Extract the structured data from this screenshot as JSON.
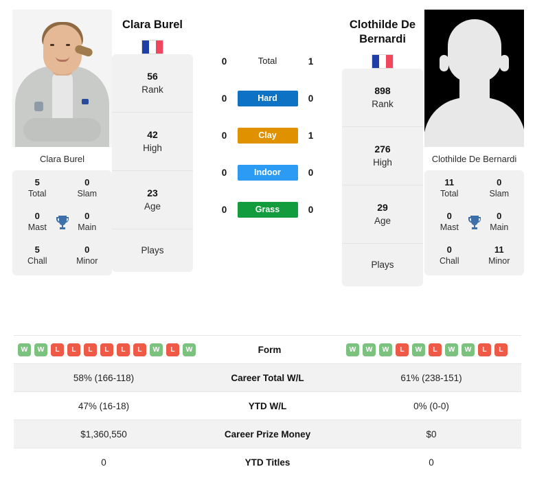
{
  "players": {
    "left": {
      "name": "Clara Burel",
      "photo_caption": "Clara Burel",
      "flag": "fr",
      "titles": {
        "total_value": "5",
        "total_label": "Total",
        "slam_value": "0",
        "slam_label": "Slam",
        "mast_value": "0",
        "mast_label": "Mast",
        "main_value": "0",
        "main_label": "Main",
        "chall_value": "5",
        "chall_label": "Chall",
        "minor_value": "0",
        "minor_label": "Minor"
      },
      "rank_value": "56",
      "rank_label": "Rank",
      "high_value": "42",
      "high_label": "High",
      "age_value": "23",
      "age_label": "Age",
      "plays_label": "Plays",
      "form": [
        "W",
        "W",
        "L",
        "L",
        "L",
        "L",
        "L",
        "L",
        "W",
        "L",
        "W"
      ],
      "career_total_wl": "58% (166-118)",
      "ytd_wl": "47% (16-18)",
      "career_prize_money": "$1,360,550",
      "ytd_titles": "0"
    },
    "right": {
      "name": "Clothilde De Bernardi",
      "photo_caption": "Clothilde De Bernardi",
      "flag": "fr",
      "titles": {
        "total_value": "11",
        "total_label": "Total",
        "slam_value": "0",
        "slam_label": "Slam",
        "mast_value": "0",
        "mast_label": "Mast",
        "main_value": "0",
        "main_label": "Main",
        "chall_value": "0",
        "chall_label": "Chall",
        "minor_value": "11",
        "minor_label": "Minor"
      },
      "rank_value": "898",
      "rank_label": "Rank",
      "high_value": "276",
      "high_label": "High",
      "age_value": "29",
      "age_label": "Age",
      "plays_label": "Plays",
      "form": [
        "W",
        "W",
        "W",
        "L",
        "W",
        "L",
        "W",
        "W",
        "L",
        "L"
      ],
      "career_total_wl": "61% (238-151)",
      "ytd_wl": "0% (0-0)",
      "career_prize_money": "$0",
      "ytd_titles": "0"
    }
  },
  "h2h": {
    "rows": [
      {
        "label": "Total",
        "left": "0",
        "right": "1",
        "color": null
      },
      {
        "label": "Hard",
        "left": "0",
        "right": "0",
        "color": "#0d72c4"
      },
      {
        "label": "Clay",
        "left": "0",
        "right": "1",
        "color": "#e09100"
      },
      {
        "label": "Indoor",
        "left": "0",
        "right": "0",
        "color": "#2b9bf4"
      },
      {
        "label": "Grass",
        "left": "0",
        "right": "0",
        "color": "#129c3d"
      }
    ]
  },
  "stats_table": {
    "rows": [
      {
        "label": "Form",
        "type": "form"
      },
      {
        "label": "Career Total W/L",
        "type": "text",
        "key": "career_total_wl"
      },
      {
        "label": "YTD W/L",
        "type": "text",
        "key": "ytd_wl"
      },
      {
        "label": "Career Prize Money",
        "type": "text",
        "key": "career_prize_money"
      },
      {
        "label": "YTD Titles",
        "type": "text",
        "key": "ytd_titles"
      }
    ]
  },
  "colors": {
    "hard": "#0d72c4",
    "clay": "#e09100",
    "indoor": "#2b9bf4",
    "grass": "#129c3d",
    "win": "#7ac27e",
    "loss": "#ef5a47",
    "trophy": "#3d6fa8",
    "panel": "#f1f1f1"
  },
  "flag_colors": {
    "blue": "#1f3ea8",
    "white": "#ffffff",
    "red": "#f0475e"
  }
}
